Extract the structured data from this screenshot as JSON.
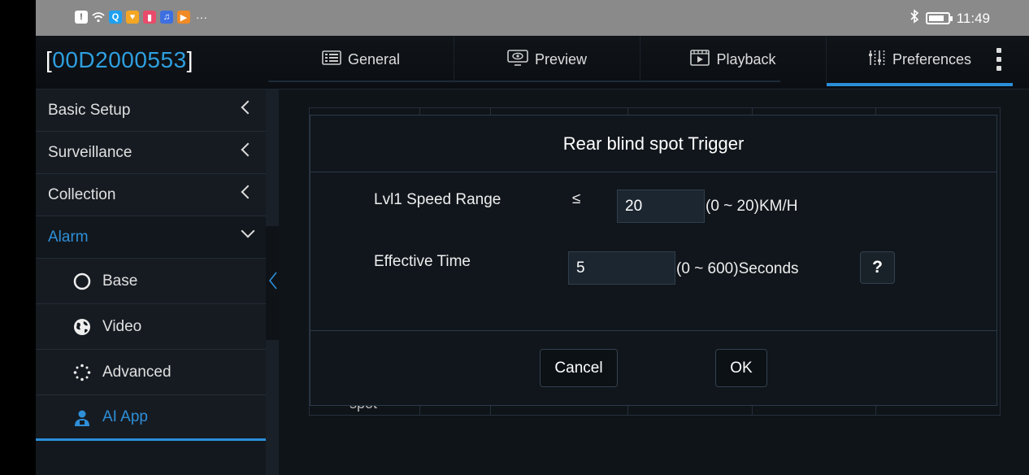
{
  "status_bar": {
    "time": "11:49",
    "overflow": "···"
  },
  "header": {
    "device_id_open": "[",
    "device_id": "00D2000553",
    "device_id_close": "]",
    "tabs": [
      {
        "label": "General",
        "icon": "grid-icon"
      },
      {
        "label": "Preview",
        "icon": "eye-monitor-icon"
      },
      {
        "label": "Playback",
        "icon": "film-icon"
      },
      {
        "label": "Preferences",
        "icon": "sliders-icon"
      }
    ],
    "active_tab": "Preferences"
  },
  "sidebar": {
    "items": [
      {
        "label": "Basic Setup"
      },
      {
        "label": "Surveillance"
      },
      {
        "label": "Collection"
      },
      {
        "label": "Alarm"
      }
    ],
    "sub_items": [
      {
        "label": "Base",
        "icon": "circle-icon"
      },
      {
        "label": "Video",
        "icon": "globe-icon"
      },
      {
        "label": "Advanced",
        "icon": "dotted-circle-icon"
      },
      {
        "label": "AI App",
        "icon": "person-icon"
      }
    ]
  },
  "background": {
    "partial_text": "spot"
  },
  "dialog": {
    "title": "Rear blind spot Trigger",
    "speed_label": "Lvl1 Speed Range",
    "speed_operator": "≤",
    "speed_value": "20",
    "speed_unit": "(0 ~ 20)KM/H",
    "time_label": "Effective Time",
    "time_value": "5",
    "time_unit": "(0 ~ 600)Seconds",
    "help_label": "?",
    "cancel_label": "Cancel",
    "ok_label": "OK"
  },
  "colors": {
    "accent": "#2a8fd8",
    "background": "#0f1419"
  }
}
